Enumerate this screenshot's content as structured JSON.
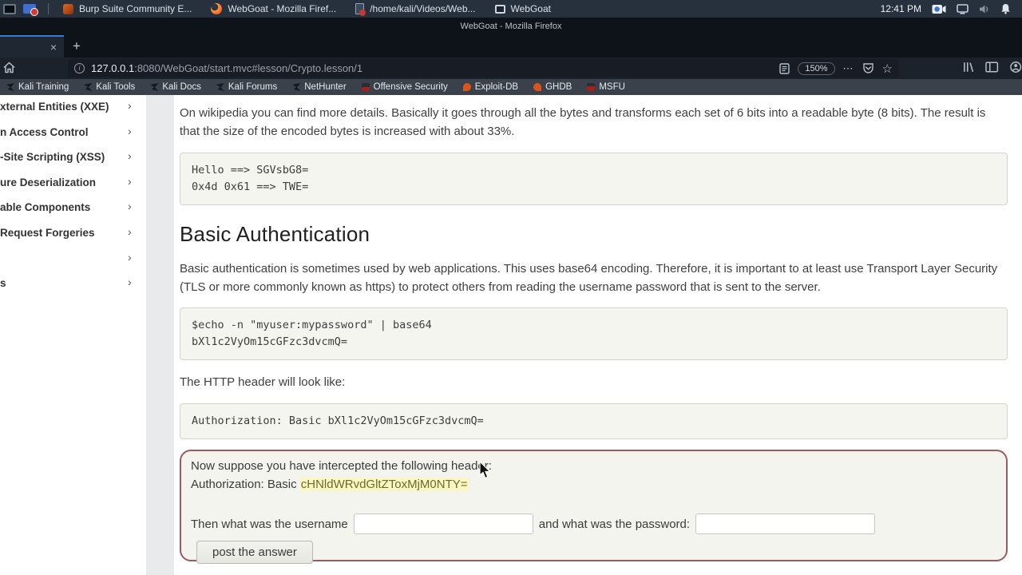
{
  "colors": {
    "panel_bg": "#27303d",
    "accent_blue": "#3a7bd5",
    "attack_border": "#9e5a62",
    "highlight": "#fbf7c5"
  },
  "glyphs": {
    "close": "×",
    "new_tab": "+",
    "chevron": "›",
    "star": "☆",
    "ellipsis": "⋯",
    "info": "i"
  },
  "taskbar": {
    "windows": [
      {
        "label": "Burp Suite Community E..."
      },
      {
        "label": "WebGoat - Mozilla Firef..."
      },
      {
        "label": "/home/kali/Videos/Web..."
      },
      {
        "label": "WebGoat"
      }
    ],
    "clock": "12:41 PM"
  },
  "titlebar": {
    "title": "WebGoat - Mozilla Firefox"
  },
  "navbar": {
    "url_host": "127.0.0.1",
    "url_rest": ":8080/WebGoat/start.mvc#lesson/Crypto.lesson/1",
    "zoom_level": "150%"
  },
  "bookmarks": [
    {
      "label": "Kali Training"
    },
    {
      "label": "Kali Tools"
    },
    {
      "label": "Kali Docs"
    },
    {
      "label": "Kali Forums"
    },
    {
      "label": "NetHunter"
    },
    {
      "label": "Offensive Security"
    },
    {
      "label": "Exploit-DB"
    },
    {
      "label": "GHDB"
    },
    {
      "label": "MSFU"
    }
  ],
  "sidebar": {
    "items": [
      {
        "label": "xternal Entities (XXE)"
      },
      {
        "label": "n Access Control"
      },
      {
        "label": "-Site Scripting (XSS)"
      },
      {
        "label": "ure Deserialization"
      },
      {
        "label": "able Components"
      },
      {
        "label": "Request Forgeries"
      },
      {
        "label": ""
      },
      {
        "label": "s"
      }
    ]
  },
  "lesson": {
    "intro": "On wikipedia you can find more details. Basically it goes through all the bytes and transforms each set of 6 bits into a readable byte (8 bits). The result is that the size of the encoded bytes is increased with about 33%.",
    "code_example": {
      "line1": "Hello ==> SGVsbG8=",
      "line2": "0x4d 0x61 ==> TWE="
    },
    "heading": "Basic Authentication",
    "body": "Basic authentication is sometimes used by web applications. This uses base64 encoding. Therefore, it is important to at least use Transport Layer Security (TLS or more commonly known as https) to protect others from reading the username password that is sent to the server.",
    "code_base64": {
      "line1": "$echo -n \"myuser:mypassword\" | base64",
      "line2": "bXl1c2VyOm15cGFzc3dvcmQ="
    },
    "header_intro": "The HTTP header will look like:",
    "code_header": {
      "line1": "Authorization: Basic bXl1c2VyOm15cGFzc3dvcmQ="
    },
    "assignment": {
      "prompt": "Now suppose you have intercepted the following header:",
      "header_prefix": "Authorization: Basic ",
      "header_value": "cHNldWRvdGltZToxMjM0NTY=",
      "username_label": "Then what was the username",
      "password_label": "and what was the password:",
      "username_value": "",
      "password_value": "",
      "submit_label": "post the answer"
    }
  }
}
